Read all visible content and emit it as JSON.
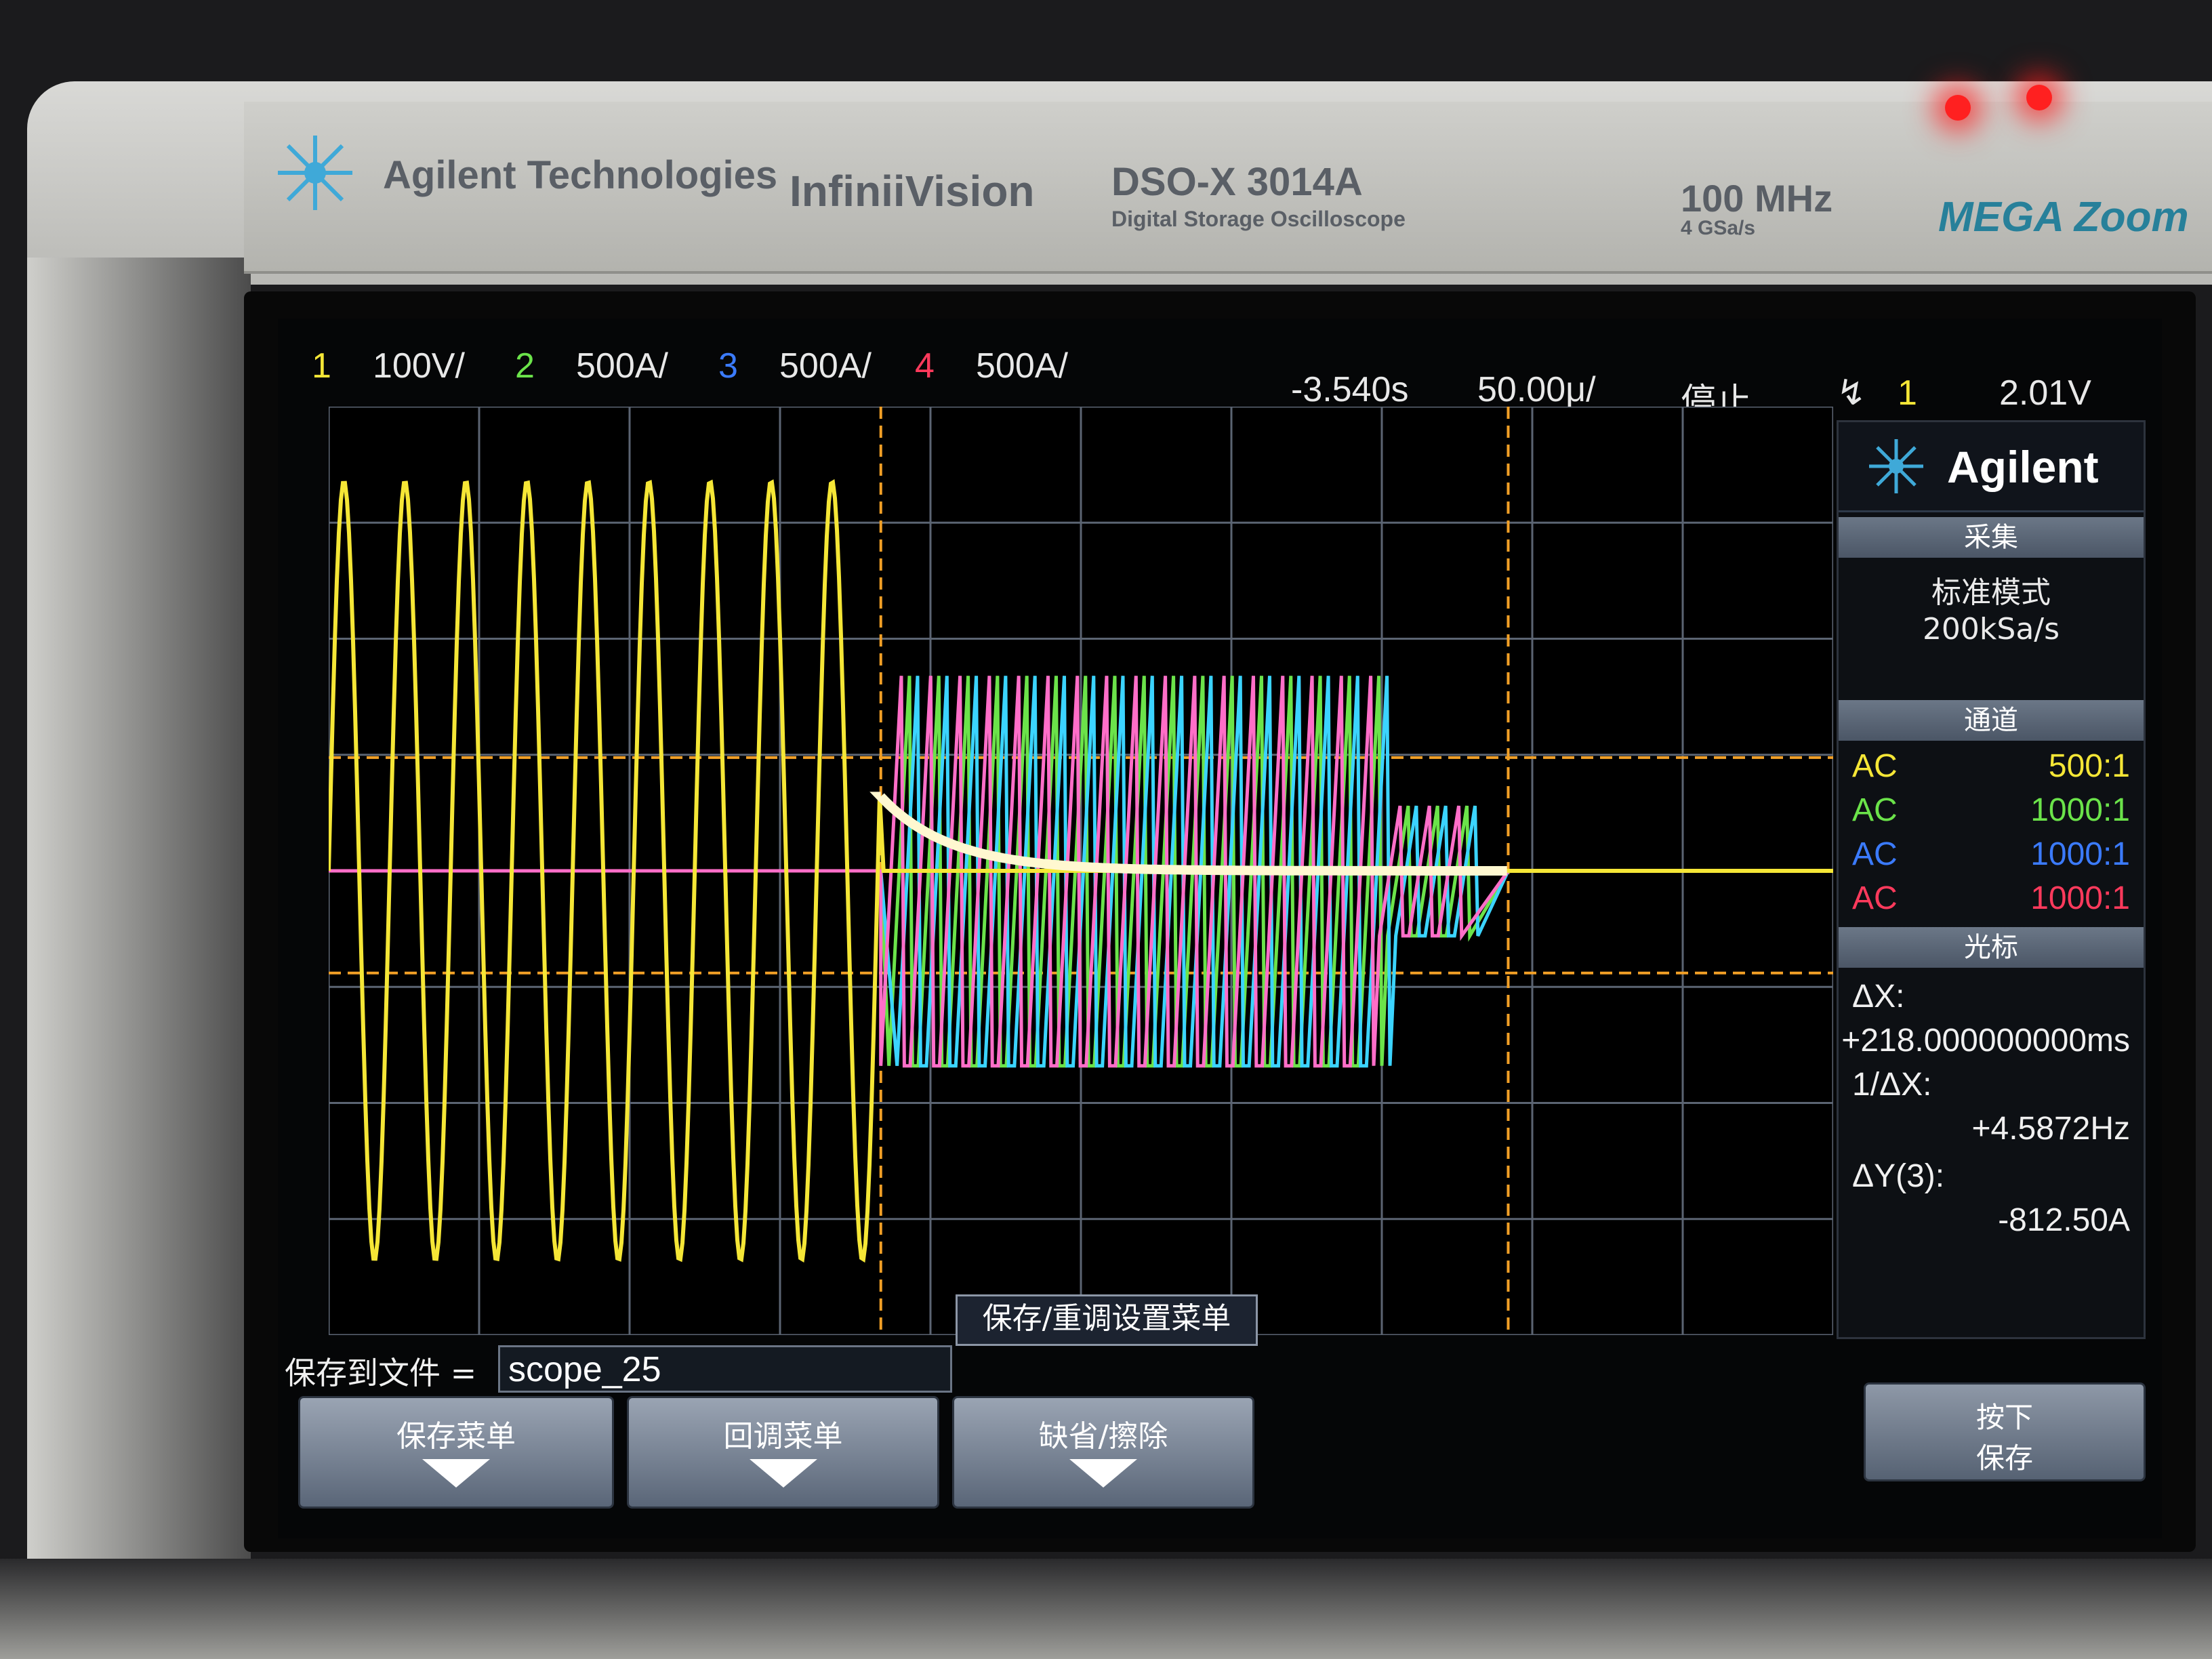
{
  "header": {
    "company": "Agilent Technologies",
    "product_line": "InfiniiVision",
    "model": "DSO-X 3014A",
    "model_desc": "Digital Storage Oscilloscope",
    "bandwidth": "100 MHz",
    "sample_rate": "4 GSa/s",
    "badge": "MEGA Zoom"
  },
  "status_bar": {
    "ch1_num": "1",
    "ch1_scale": "100V/",
    "ch2_num": "2",
    "ch2_scale": "500A/",
    "ch3_num": "3",
    "ch3_scale": "500A/",
    "ch4_num": "4",
    "ch4_scale": "500A/",
    "time_offset": "-3.540s",
    "time_scale": "50.00μ/",
    "run_state": "停止",
    "trigger_channel": "1",
    "trigger_level": "2.01V"
  },
  "side_panel": {
    "logo": "Agilent",
    "acquire_title": "采集",
    "acquire_mode": "标准模式",
    "acquire_rate": "200kSa/s",
    "channels_title": "通道",
    "channels": [
      {
        "coupling": "AC",
        "probe": "500:1",
        "color": "#f5e636"
      },
      {
        "coupling": "AC",
        "probe": "1000:1",
        "color": "#6be34a"
      },
      {
        "coupling": "AC",
        "probe": "1000:1",
        "color": "#3b7bff"
      },
      {
        "coupling": "AC",
        "probe": "1000:1",
        "color": "#ff3a5c"
      }
    ],
    "cursor_title": "光标",
    "dx_label": "ΔX:",
    "dx_value": "+218.000000000ms",
    "inv_dx_label": "1/ΔX:",
    "inv_dx_value": "+4.5872Hz",
    "dy_label": "ΔY(3):",
    "dy_value": "-812.50A"
  },
  "menu": {
    "title": "保存/重调设置菜单",
    "save_to_file_label": "保存到文件 =",
    "file_name": "scope_25",
    "softkeys": [
      {
        "label": "保存菜单"
      },
      {
        "label": "回调菜单"
      },
      {
        "label": "缺省/擦除"
      }
    ],
    "hint_line1": "按下",
    "hint_line2": "保存"
  },
  "colors": {
    "ch1": "#f5e636",
    "ch2": "#6be34a",
    "ch3": "#3bd4ff",
    "ch4": "#ff6ec8",
    "cursor": "#f2a026",
    "grid": "#5b6472"
  }
}
